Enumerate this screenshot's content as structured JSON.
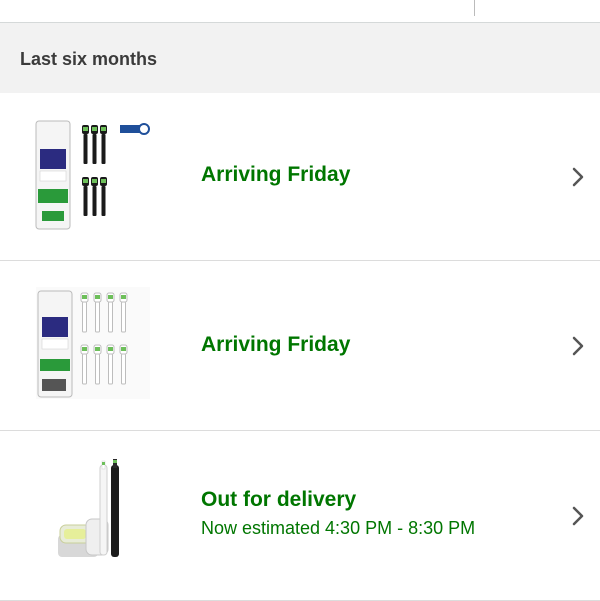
{
  "section": {
    "title": "Last six months"
  },
  "orders": [
    {
      "status": "Arriving Friday",
      "subtitle": "",
      "product_icon": "philips-black-brush-heads-package"
    },
    {
      "status": "Arriving Friday",
      "subtitle": "",
      "product_icon": "philips-white-brush-heads-package"
    },
    {
      "status": "Out for delivery",
      "subtitle": "Now estimated 4:30 PM - 8:30 PM",
      "product_icon": "electric-toothbrush-set"
    }
  ],
  "colors": {
    "status_green": "#007600",
    "header_bg": "#f2f2f2",
    "divider": "#dcdcdc"
  },
  "icons": {
    "row_chevron": "chevron-right-icon"
  }
}
